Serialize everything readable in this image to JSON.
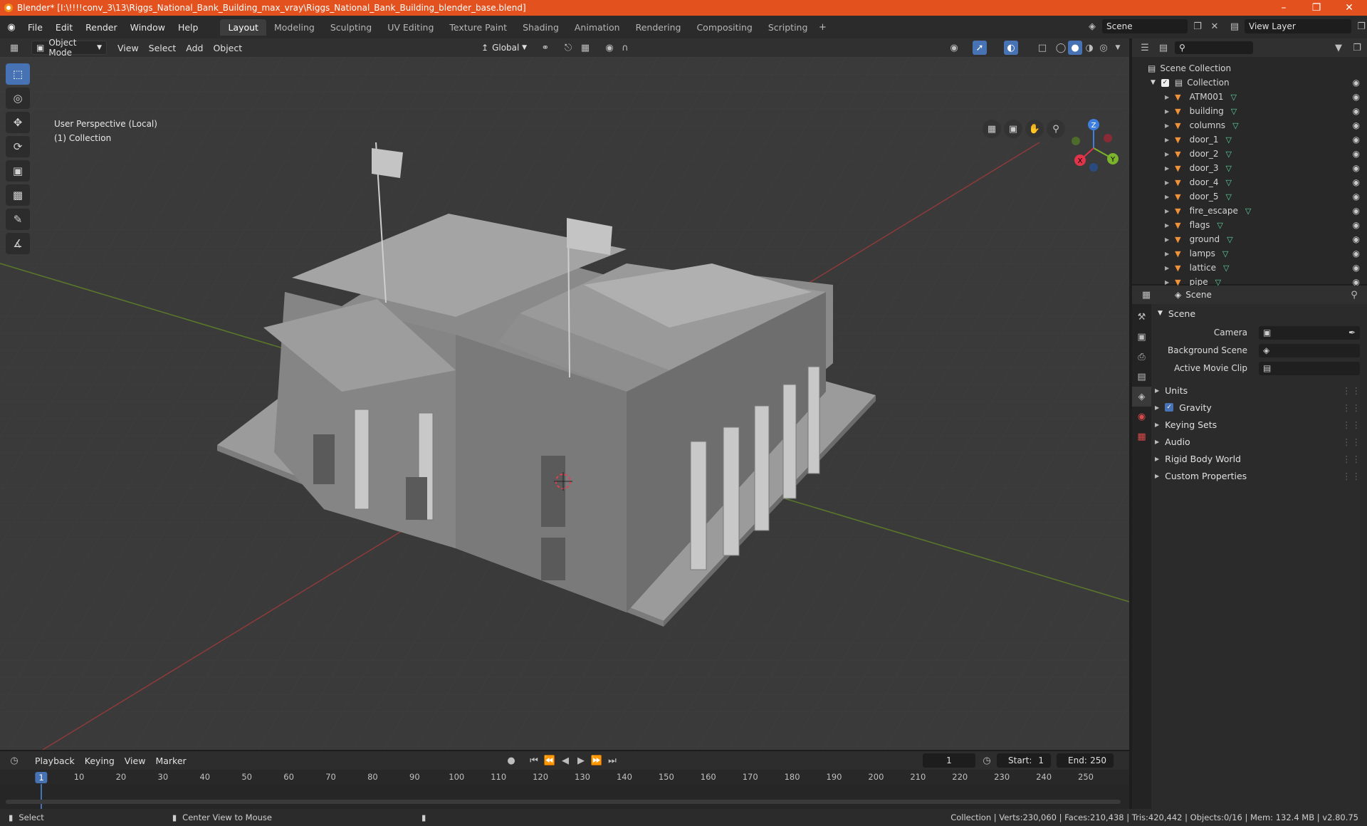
{
  "title_bar": {
    "title": "Blender* [I:\\!!!!conv_3\\13\\Riggs_National_Bank_Building_max_vray\\Riggs_National_Bank_Building_blender_base.blend]"
  },
  "menu": [
    "File",
    "Edit",
    "Render",
    "Window",
    "Help"
  ],
  "workspaces": [
    "Layout",
    "Modeling",
    "Sculpting",
    "UV Editing",
    "Texture Paint",
    "Shading",
    "Animation",
    "Rendering",
    "Compositing",
    "Scripting"
  ],
  "active_workspace": "Layout",
  "scene_field": "Scene",
  "view_layer_field": "View Layer",
  "viewport_header": {
    "mode": "Object Mode",
    "menus": [
      "View",
      "Select",
      "Add",
      "Object"
    ],
    "orientation": "Global"
  },
  "viewport": {
    "perspective_label": "User Perspective (Local)",
    "collection_label": "(1) Collection",
    "gizmo": {
      "x": "X",
      "y": "Y",
      "z": "Z"
    }
  },
  "outliner": {
    "root": "Scene Collection",
    "collection": "Collection",
    "items": [
      "ATM001",
      "building",
      "columns",
      "door_1",
      "door_2",
      "door_3",
      "door_4",
      "door_5",
      "fire_escape",
      "flags",
      "ground",
      "lamps",
      "lattice",
      "pipe"
    ]
  },
  "properties": {
    "header": "Scene",
    "section": "Scene",
    "fields": [
      {
        "label": "Camera",
        "value": ""
      },
      {
        "label": "Background Scene",
        "value": ""
      },
      {
        "label": "Active Movie Clip",
        "value": ""
      }
    ],
    "panels": [
      "Units",
      "Gravity",
      "Keying Sets",
      "Audio",
      "Rigid Body World",
      "Custom Properties"
    ],
    "gravity_checked": true
  },
  "timeline": {
    "menus": [
      "Playback",
      "Keying",
      "View",
      "Marker"
    ],
    "current_frame": "1",
    "start_label": "Start:",
    "start": "1",
    "end_label": "End:",
    "end": "250",
    "ruler": [
      "1",
      "10",
      "20",
      "30",
      "40",
      "50",
      "60",
      "70",
      "80",
      "90",
      "100",
      "110",
      "120",
      "130",
      "140",
      "150",
      "160",
      "170",
      "180",
      "190",
      "200",
      "210",
      "220",
      "230",
      "240",
      "250"
    ]
  },
  "statusbar": {
    "left": "Select",
    "middle": "Center View to Mouse",
    "right": "Collection | Verts:230,060 | Faces:210,438 | Tris:420,442 | Objects:0/16 | Mem: 132.4 MB | v2.80.75"
  },
  "colors": {
    "accent": "#4772b3",
    "title_bar": "#e2511e",
    "x_axis": "#e0344a",
    "y_axis": "#7bb32c",
    "z_axis": "#3d7ede"
  }
}
